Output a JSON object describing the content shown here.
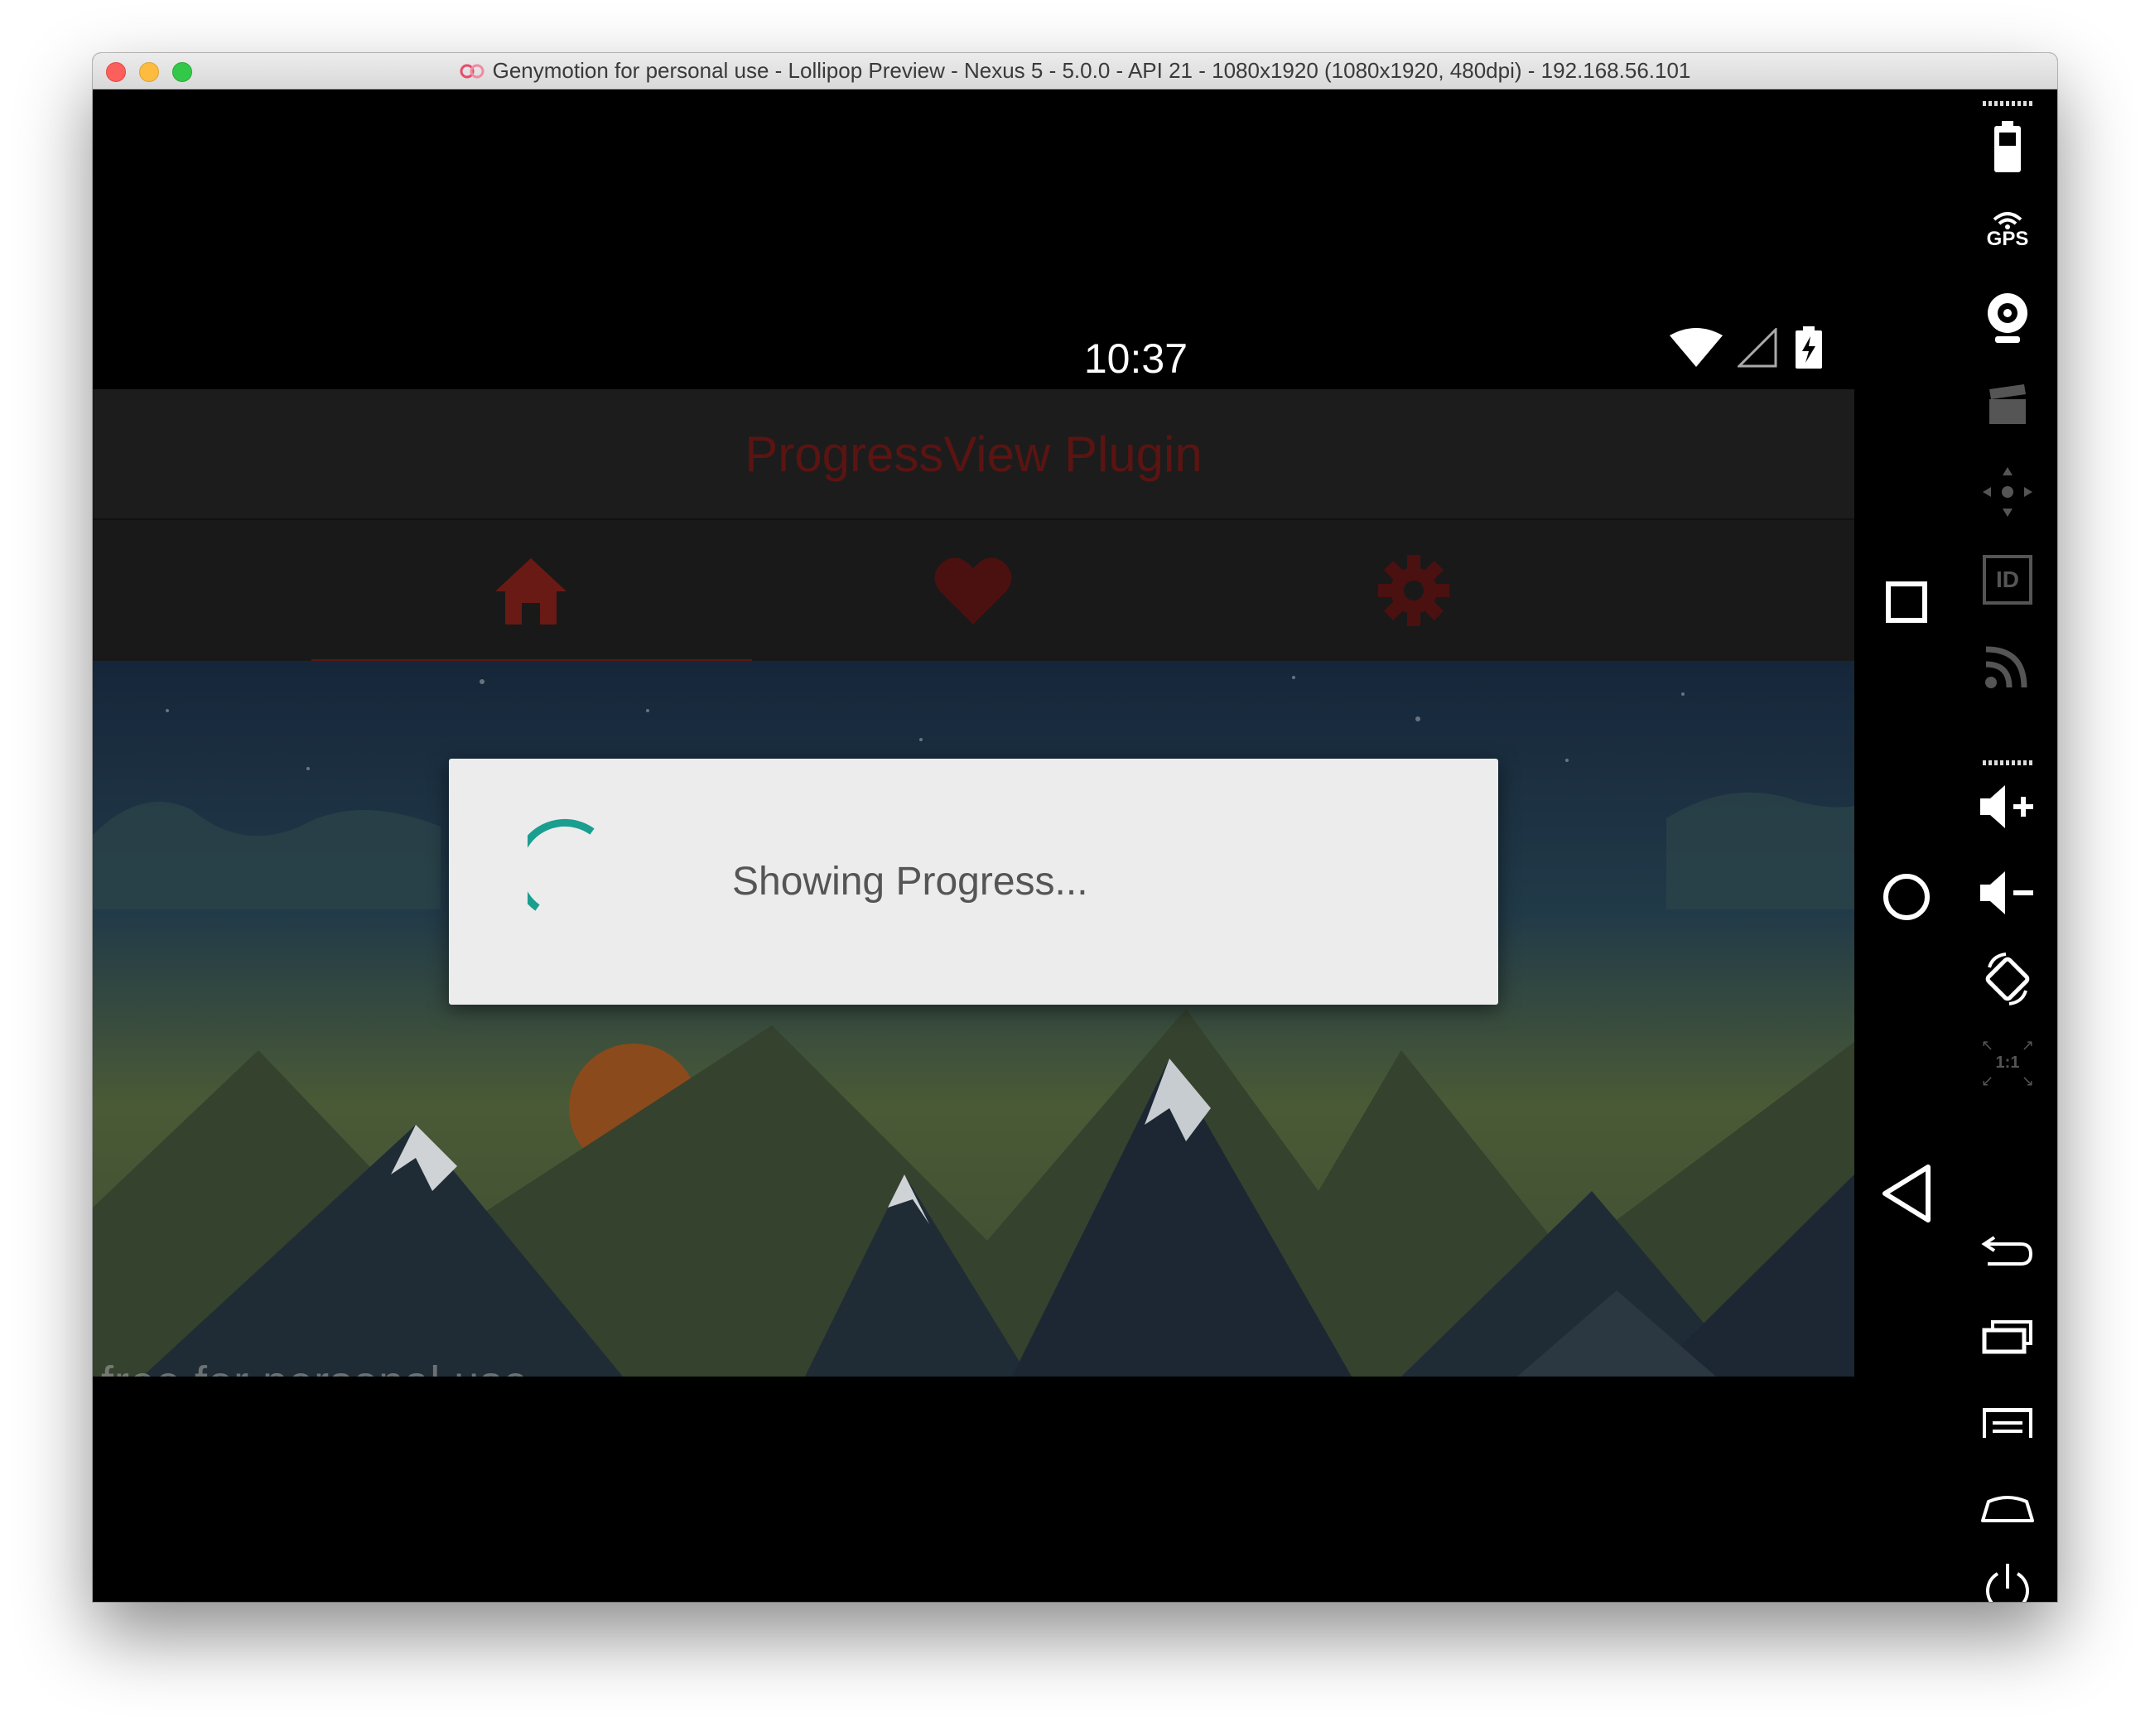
{
  "window": {
    "title": "Genymotion for personal use - Lollipop Preview - Nexus 5 - 5.0.0 - API 21 - 1080x1920 (1080x1920, 480dpi) - 192.168.56.101"
  },
  "status_bar": {
    "time": "10:37",
    "icons": [
      "wifi-icon",
      "cell-signal-icon",
      "battery-charging-icon"
    ]
  },
  "app": {
    "title": "ProgressView Plugin",
    "tabs": [
      {
        "icon": "home-icon",
        "selected": true
      },
      {
        "icon": "heart-icon",
        "selected": false
      },
      {
        "icon": "gear-icon",
        "selected": false
      }
    ],
    "watermark": "free for personal use",
    "colors": {
      "accent": "#5b1814",
      "spinner": "#1a9e8f",
      "title": "#5a1412"
    }
  },
  "dialog": {
    "message": "Showing Progress..."
  },
  "android_nav": [
    "recents-button",
    "home-button",
    "back-button"
  ],
  "genymotion_toolbar": [
    "battery-icon",
    "gps-icon",
    "webcam-icon",
    "capture-icon",
    "remote-control-icon",
    "device-id-icon",
    "rss-icon",
    "volume-up-icon",
    "volume-down-icon",
    "rotate-icon",
    "pixel-perfect-icon",
    "back-icon",
    "recent-apps-icon",
    "menu-icon",
    "home-icon",
    "power-icon"
  ],
  "gps_label": "GPS",
  "id_label": "ID",
  "pixel_label": "1:1"
}
